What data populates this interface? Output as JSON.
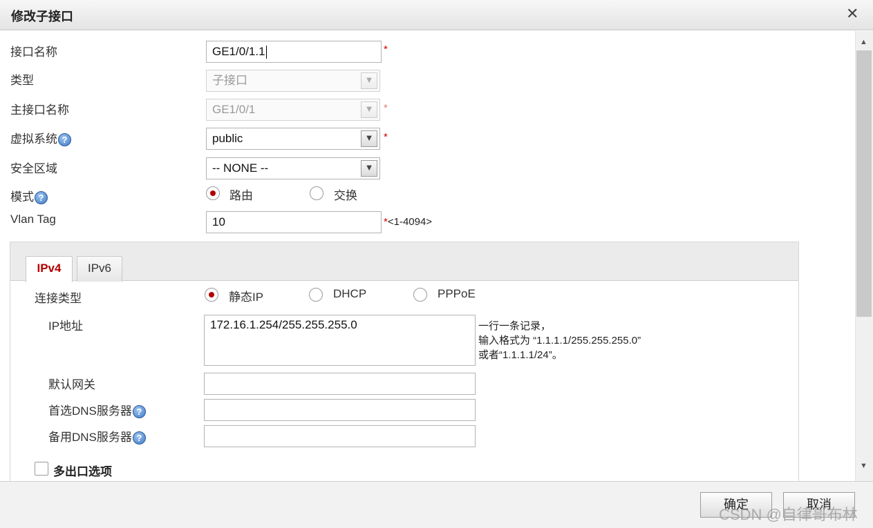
{
  "dialog": {
    "title": "修改子接口",
    "close_glyph": "✕"
  },
  "form": {
    "interface_name": {
      "label": "接口名称",
      "value": "GE1/0/1.1",
      "required": "*"
    },
    "type": {
      "label": "类型",
      "value": "子接口"
    },
    "main_interface": {
      "label": "主接口名称",
      "value": "GE1/0/1",
      "required": "*"
    },
    "virtual_system": {
      "label": "虚拟系统",
      "value": "public",
      "required": "*"
    },
    "security_zone": {
      "label": "安全区域",
      "value": "-- NONE --"
    },
    "mode": {
      "label": "模式",
      "options": [
        "路由",
        "交换"
      ],
      "selected": "路由"
    },
    "vlan_tag": {
      "label": "Vlan Tag",
      "value": "10",
      "required": "*",
      "range": "<1-4094>"
    }
  },
  "tabs": [
    {
      "label": "IPv4",
      "active": true
    },
    {
      "label": "IPv6",
      "active": false
    }
  ],
  "ipv4": {
    "connection_type": {
      "label": "连接类型",
      "options": [
        "静态IP",
        "DHCP",
        "PPPoE"
      ],
      "selected": "静态IP"
    },
    "ip_address": {
      "label": "IP地址",
      "value": "172.16.1.254/255.255.255.0",
      "hint_lines": [
        "一行一条记录，",
        "输入格式为 “1.1.1.1/255.255.255.0”",
        "或者“1.1.1.1/24”。"
      ]
    },
    "gateway": {
      "label": "默认网关",
      "value": ""
    },
    "dns_primary": {
      "label": "首选DNS服务器",
      "value": ""
    },
    "dns_secondary": {
      "label": "备用DNS服务器",
      "value": ""
    },
    "multi_egress": {
      "label": "多出口选项",
      "checked": false
    }
  },
  "icons": {
    "help": "?",
    "dropdown": "▼",
    "scroll_up": "▲",
    "scroll_down": "▼"
  },
  "footer": {
    "ok_label": "确定",
    "cancel_label": "取消"
  },
  "watermark": "CSDN @自律哥布林",
  "colors": {
    "accent": "#b30000",
    "required": "#d00000",
    "help_icon": "#3f79c4"
  }
}
